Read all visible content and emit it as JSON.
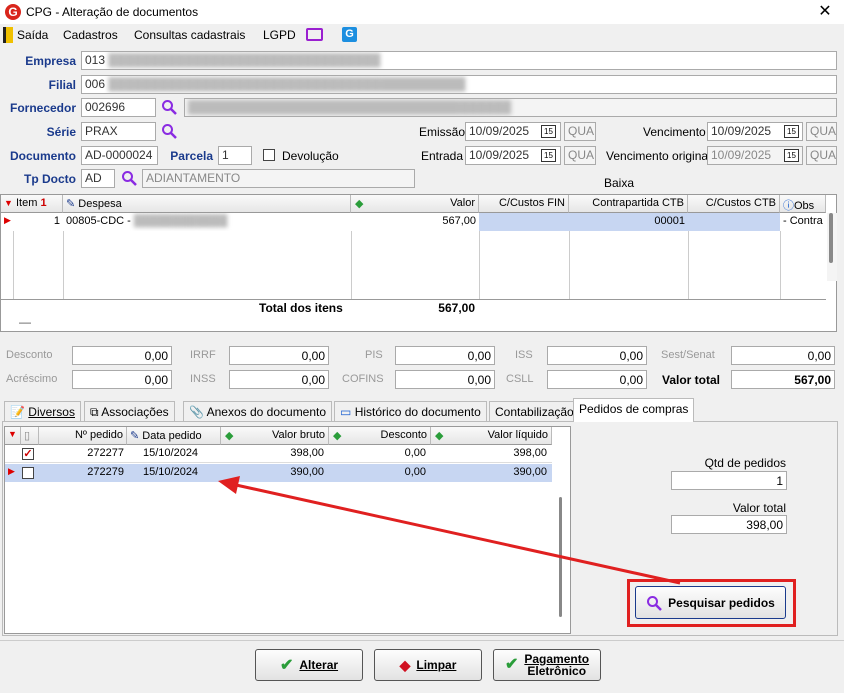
{
  "window": {
    "title": "CPG - Alteração de documentos",
    "logo_letter": "G",
    "close": "✕"
  },
  "menu": {
    "items": [
      "Saída",
      "Cadastros",
      "Consultas cadastrais",
      "LGPD"
    ]
  },
  "form": {
    "empresa_label": "Empresa",
    "empresa_value": "013",
    "filial_label": "Filial",
    "filial_value": "006",
    "fornecedor_label": "Fornecedor",
    "fornecedor_value": "002696",
    "serie_label": "Série",
    "serie_value": "PRAX",
    "documento_label": "Documento",
    "documento_value": "AD-0000024",
    "parcela_label": "Parcela",
    "parcela_value": "1",
    "devolucao_label": "Devolução",
    "tpdocto_label": "Tp Docto",
    "tpdocto_value": "AD",
    "tpdocto_desc": "ADIANTAMENTO",
    "emissao_label": "Emissão",
    "emissao_value": "10/09/2025",
    "emissao_day": "QUA",
    "entrada_label": "Entrada",
    "entrada_value": "10/09/2025",
    "entrada_day": "QUA",
    "vencimento_label": "Vencimento",
    "vencimento_value": "10/09/2025",
    "vencimento_day": "QUA",
    "venc_original_label": "Vencimento original",
    "venc_original_value": "10/09/2025",
    "venc_original_day": "QUA",
    "baixa_label": "Baixa",
    "cal_icon": "15"
  },
  "items_grid": {
    "headers": {
      "item": "Item",
      "item_sort": "1",
      "despesa": "Despesa",
      "valor": "Valor",
      "ccfin": "C/Custos FIN",
      "contrapartida": "Contrapartida CTB",
      "ccctb": "C/Custos CTB",
      "obs": "Obs"
    },
    "row": {
      "item": "1",
      "despesa": "00805-CDC -",
      "valor": "567,00",
      "contrapartida": "00001",
      "obs": "- Contra"
    },
    "total_label": "Total dos itens",
    "total_value": "567,00",
    "collapse": "—"
  },
  "totals": {
    "desconto_label": "Desconto",
    "desconto": "0,00",
    "acrescimo_label": "Acréscimo",
    "acrescimo": "0,00",
    "irrf_label": "IRRF",
    "irrf": "0,00",
    "inss_label": "INSS",
    "inss": "0,00",
    "pis_label": "PIS",
    "pis": "0,00",
    "cofins_label": "COFINS",
    "cofins": "0,00",
    "iss_label": "ISS",
    "iss": "0,00",
    "csll_label": "CSLL",
    "csll": "0,00",
    "sest_label": "Sest/Senat",
    "sest": "0,00",
    "valor_total_label": "Valor total",
    "valor_total": "567,00"
  },
  "tabs": [
    "Diversos",
    "Associações",
    "Anexos do documento",
    "Histórico do documento",
    "Contabilização",
    "Pedidos de compras"
  ],
  "orders_grid": {
    "headers": {
      "pedido": "Nº pedido",
      "data": "Data pedido",
      "bruto": "Valor bruto",
      "desconto": "Desconto",
      "liquido": "Valor líquido"
    },
    "rows": [
      {
        "pedido": "272277",
        "data": "15/10/2024",
        "bruto": "398,00",
        "desconto": "0,00",
        "liquido": "398,00",
        "checked": true
      },
      {
        "pedido": "272279",
        "data": "15/10/2024",
        "bruto": "390,00",
        "desconto": "0,00",
        "liquido": "390,00",
        "checked": false
      }
    ]
  },
  "summary": {
    "qtd_label": "Qtd de pedidos",
    "qtd_value": "1",
    "valor_label": "Valor total",
    "valor_value": "398,00"
  },
  "search_button": "Pesquisar pedidos",
  "footer": {
    "alterar": "Alterar",
    "limpar": "Limpar",
    "pagamento_line1": "Pagamento",
    "pagamento_line2": "Eletrônico"
  },
  "colors": {
    "accent": "#1a3a8c",
    "highlight": "#c7d6f2",
    "annotation": "#e02020"
  }
}
